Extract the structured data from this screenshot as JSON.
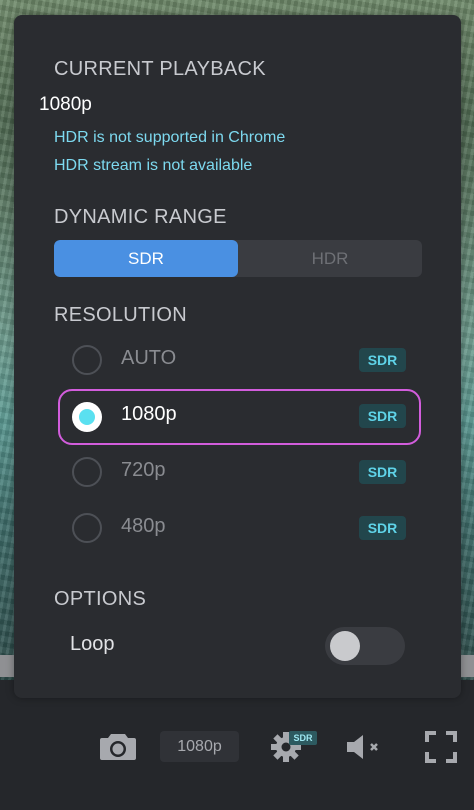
{
  "current_playback": {
    "heading": "CURRENT PLAYBACK",
    "value": "1080p",
    "notes": [
      "HDR is not supported in Chrome",
      "HDR stream is not available"
    ]
  },
  "dynamic_range": {
    "heading": "DYNAMIC RANGE",
    "options": [
      "SDR",
      "HDR"
    ],
    "selected": "SDR"
  },
  "resolution": {
    "heading": "RESOLUTION",
    "options": [
      {
        "label": "AUTO",
        "badge": "SDR",
        "selected": false
      },
      {
        "label": "1080p",
        "badge": "SDR",
        "selected": true
      },
      {
        "label": "720p",
        "badge": "SDR",
        "selected": false
      },
      {
        "label": "480p",
        "badge": "SDR",
        "selected": false
      }
    ]
  },
  "options": {
    "heading": "OPTIONS",
    "loop_label": "Loop",
    "loop_enabled": false
  },
  "controls": {
    "quality_label": "1080p",
    "settings_badge": "SDR",
    "icons": [
      "camera-icon",
      "gear-icon",
      "volume-muted-icon",
      "fullscreen-icon"
    ]
  },
  "colors": {
    "accent_blue": "#4a90e2",
    "highlight_cyan": "#5ae0f0",
    "selection_outline": "#d25ddc"
  }
}
